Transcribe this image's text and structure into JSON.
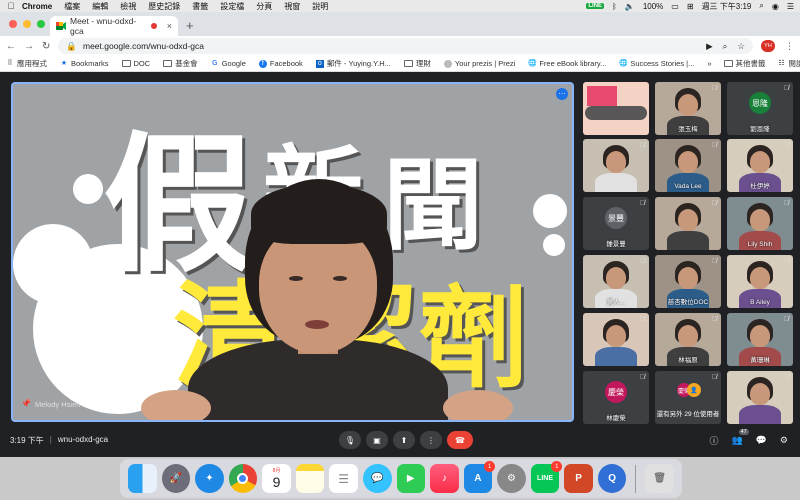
{
  "menubar": {
    "app": "Chrome",
    "items": [
      "檔案",
      "編輯",
      "檢視",
      "歷史記錄",
      "書籤",
      "設定檔",
      "分頁",
      "視窗",
      "說明"
    ],
    "battery": "100%",
    "datetime": "週三 下午3:19",
    "line_badge": "LINE"
  },
  "tab": {
    "title": "Meet - wnu-odxd-gca",
    "close": "×",
    "new_tab": "+"
  },
  "toolbar": {
    "url": "meet.google.com/wnu-odxd-gca",
    "profile_initials": "YH"
  },
  "bookmarks": {
    "items": [
      {
        "label": "應用程式",
        "icon": "apps-grid-icon"
      },
      {
        "label": "Bookmarks",
        "icon": "star-icon"
      },
      {
        "label": "DOC",
        "icon": "folder-icon"
      },
      {
        "label": "基金會",
        "icon": "folder-icon"
      },
      {
        "label": "Google",
        "icon": "google-icon"
      },
      {
        "label": "Facebook",
        "icon": "facebook-icon"
      },
      {
        "label": "郵件 - Yuying.Y.H...",
        "icon": "outlook-icon"
      },
      {
        "label": "理財",
        "icon": "folder-icon"
      },
      {
        "label": "Your prezis | Prezi",
        "icon": "prezi-icon"
      },
      {
        "label": "Free eBook library...",
        "icon": "globe-icon"
      },
      {
        "label": "Success Stories |...",
        "icon": "globe-icon"
      }
    ],
    "overflow": "»",
    "other": "其他書籤",
    "reading_list": "閱讀清單"
  },
  "main_video": {
    "poster_line1": [
      "假",
      "新",
      "聞"
    ],
    "poster_line2": [
      "清",
      "潔",
      "劑"
    ],
    "speaker_name": "Melody Hsieh"
  },
  "tiles": [
    {
      "name": "",
      "avatar": "",
      "kind": "screen"
    },
    {
      "name": "張玉梅",
      "avatar": "",
      "kind": "video"
    },
    {
      "name": "劉恩隆",
      "avatar": "恩隆",
      "kind": "avatar",
      "color": "#188038"
    },
    {
      "name": "",
      "avatar": "",
      "kind": "video"
    },
    {
      "name": "Vada Lee",
      "avatar": "",
      "kind": "video"
    },
    {
      "name": "杜伊婷",
      "avatar": "",
      "kind": "video"
    },
    {
      "name": "鍾景豐",
      "avatar": "景豐",
      "kind": "avatar",
      "color": "#5f6368"
    },
    {
      "name": "",
      "avatar": "",
      "kind": "video"
    },
    {
      "name": "Lily Shih",
      "avatar": "",
      "kind": "video"
    },
    {
      "name": "黃人...",
      "avatar": "",
      "kind": "video"
    },
    {
      "name": "慈杏數位DOC",
      "avatar": "",
      "kind": "video"
    },
    {
      "name": "B Ailey",
      "avatar": "",
      "kind": "video"
    },
    {
      "name": "",
      "avatar": "",
      "kind": "video"
    },
    {
      "name": "林福原",
      "avatar": "",
      "kind": "video"
    },
    {
      "name": "黃珊琳",
      "avatar": "",
      "kind": "video"
    },
    {
      "name": "林慶榮",
      "avatar": "慶榮",
      "kind": "avatar",
      "color": "#c2185b"
    },
    {
      "name": "還有另外 29 位使用者",
      "avatar": "",
      "kind": "more"
    },
    {
      "name": "",
      "avatar": "",
      "kind": "video"
    }
  ],
  "more_avatars": [
    "慶榮",
    "👤"
  ],
  "controls": {
    "time": "3:19 下午",
    "separator": "|",
    "meeting_code": "wnu-odxd-gca",
    "participant_count": "47"
  },
  "dock": {
    "calendar_month": "8月",
    "calendar_day": "9",
    "appstore_badge": "1",
    "line_badge": "1",
    "line_label": "LINE",
    "ppt_label": "P"
  },
  "colors": {
    "meet_bg": "#202124",
    "active_border": "#8ab4f8",
    "end_call": "#ea4335",
    "poster_yellow": "#ffe93b"
  }
}
